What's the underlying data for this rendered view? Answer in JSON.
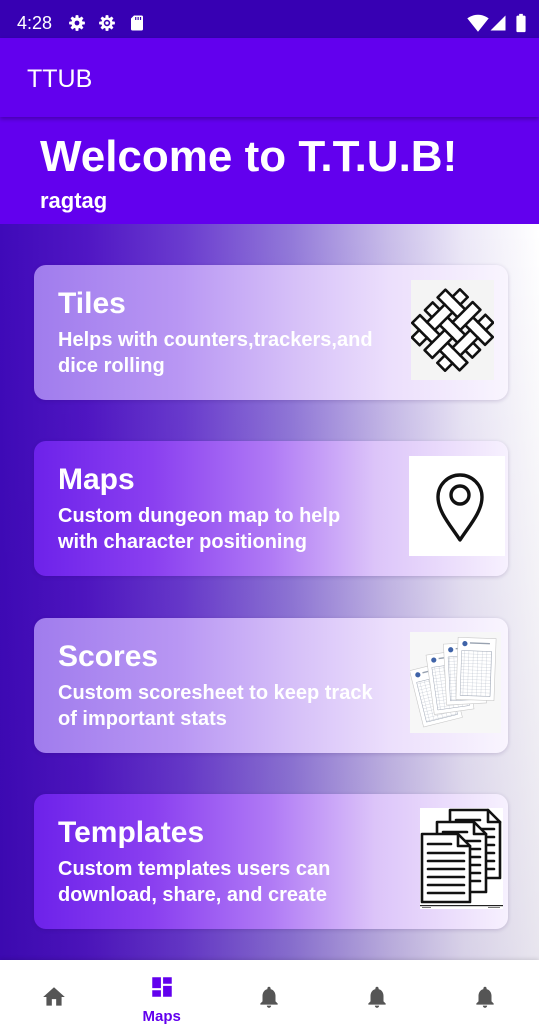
{
  "status_bar": {
    "time": "4:28",
    "left_icons": [
      "gear-icon",
      "settings-icon",
      "sd-card-icon"
    ],
    "right_icons": [
      "wifi-icon",
      "cell-signal-icon",
      "battery-icon"
    ]
  },
  "app_bar": {
    "title": "TTUB"
  },
  "header": {
    "welcome": "Welcome to T.T.U.B!",
    "username": "ragtag"
  },
  "cards": [
    {
      "title": "Tiles",
      "description": "Helps with counters,trackers,and dice rolling",
      "image": "tiles-lattice-icon"
    },
    {
      "title": "Maps",
      "description": "Custom dungeon map to help with character positioning",
      "image": "map-pin-icon"
    },
    {
      "title": "Scores",
      "description": "Custom scoresheet to keep track of important stats",
      "image": "scoresheet-image"
    },
    {
      "title": "Templates",
      "description": "Custom templates users can download, share, and create",
      "image": "documents-icon"
    }
  ],
  "bottom_nav": {
    "items": [
      {
        "icon": "home-icon",
        "selected": false
      },
      {
        "icon": "dashboard-icon",
        "label": "Maps",
        "selected": true
      },
      {
        "icon": "bell-icon",
        "selected": false
      },
      {
        "icon": "bell-icon",
        "selected": false
      },
      {
        "icon": "bell-icon",
        "selected": false
      }
    ]
  },
  "colors": {
    "status_bar": "#3700B3",
    "primary": "#6200EE",
    "on_primary": "#FFFFFF",
    "nav_inactive": "#555555",
    "nav_active": "#6200EE"
  }
}
